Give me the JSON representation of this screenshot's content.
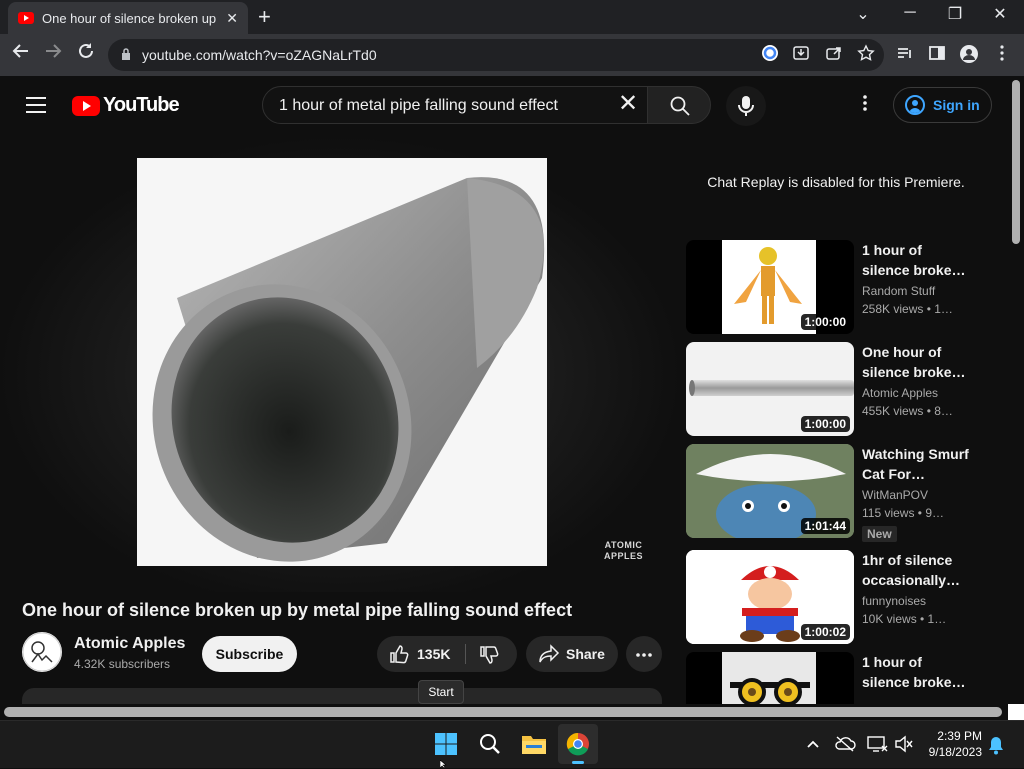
{
  "browser": {
    "tab_title": "One hour of silence broken up by metal pipe falling sound effect",
    "tab_close": "✕",
    "new_tab": "+",
    "url": "youtube.com/watch?v=oZAGNaLrTd0",
    "window_controls": {
      "tab_search": "⌄",
      "minimize": "─",
      "restore": "❐",
      "close": "✕"
    }
  },
  "header": {
    "logo_text": "YouTube",
    "search_query": "1 hour of metal pipe falling sound effect",
    "sign_in": "Sign in"
  },
  "video": {
    "watermark_line1": "ATOMIC",
    "watermark_line2": "APPLES",
    "title": "One hour of silence broken up by metal pipe falling sound effect",
    "channel": "Atomic Apples",
    "subscribers": "4.32K subscribers",
    "subscribe_label": "Subscribe",
    "likes": "135K",
    "share_label": "Share"
  },
  "sidebar": {
    "chat_replay": "Chat Replay is disabled for this Premiere.",
    "recommendations": [
      {
        "title": "1 hour of silence broke…",
        "channel": "Random Stuff",
        "meta": "258K views  • 1…",
        "duration": "1:00:00"
      },
      {
        "title": "One hour of silence broke…",
        "channel": "Atomic Apples",
        "meta": "455K views  • 8…",
        "duration": "1:00:00"
      },
      {
        "title": "Watching Smurf Cat For…",
        "channel": "WitManPOV",
        "meta": "115 views  • 9…",
        "duration": "1:01:44",
        "badge": "New"
      },
      {
        "title": "1hr of silence occasionally…",
        "channel": "funnynoises",
        "meta": "10K views  • 1…",
        "duration": "1:00:02"
      },
      {
        "title": "1 hour of silence broke…",
        "channel": "",
        "meta": "",
        "duration": ""
      }
    ]
  },
  "tooltip": "Start",
  "taskbar": {
    "time": "2:39 PM",
    "date": "9/18/2023"
  },
  "colors": {
    "yt_red": "#ff0000",
    "link_blue": "#3ea6ff",
    "bg": "#0f0f0f"
  }
}
